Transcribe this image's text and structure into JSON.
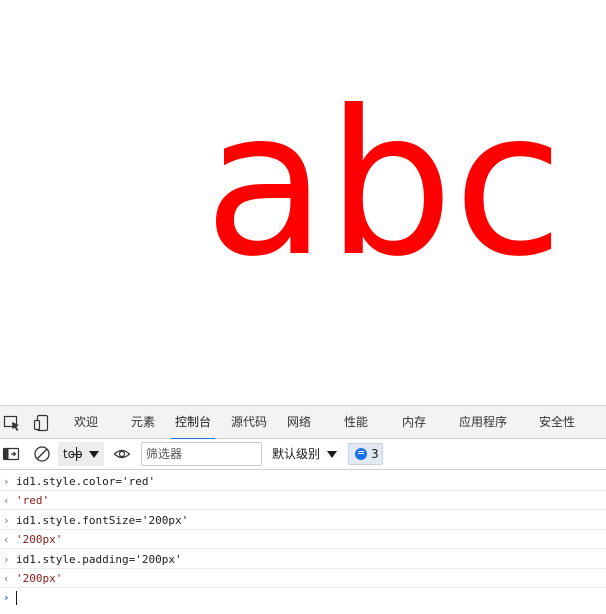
{
  "page": {
    "content_text": "abc",
    "content_color": "#ff0000"
  },
  "devtools": {
    "tabs": [
      {
        "label": "欢迎",
        "active": false
      },
      {
        "label": "元素",
        "active": false
      },
      {
        "label": "控制台",
        "active": true
      },
      {
        "label": "源代码",
        "active": false
      },
      {
        "label": "网络",
        "active": false
      },
      {
        "label": "性能",
        "active": false
      },
      {
        "label": "内存",
        "active": false
      },
      {
        "label": "应用程序",
        "active": false
      },
      {
        "label": "安全性",
        "active": false
      }
    ],
    "tab_icons": [
      "inspect-element-icon",
      "device-emulation-icon"
    ],
    "toolbar": {
      "sidebar_icon": "console-sidebar-icon",
      "clear_icon": "clear-console-icon",
      "context_value": "top",
      "eye_icon": "live-expression-icon",
      "filter_placeholder": "筛选器",
      "level_label": "默认级别",
      "issues_count": "3"
    },
    "console": {
      "entries": [
        {
          "kind": "input",
          "marker": "›",
          "text": "id1.style.color='red'"
        },
        {
          "kind": "output",
          "marker": "‹",
          "text": "'red'"
        },
        {
          "kind": "input",
          "marker": "›",
          "text": "id1.style.fontSize='200px'"
        },
        {
          "kind": "output",
          "marker": "‹",
          "text": "'200px'"
        },
        {
          "kind": "input",
          "marker": "›",
          "text": "id1.style.padding='200px'"
        },
        {
          "kind": "output",
          "marker": "‹",
          "text": "'200px'"
        }
      ],
      "prompt_marker": "›"
    },
    "accent_color": "#1a73e8"
  }
}
